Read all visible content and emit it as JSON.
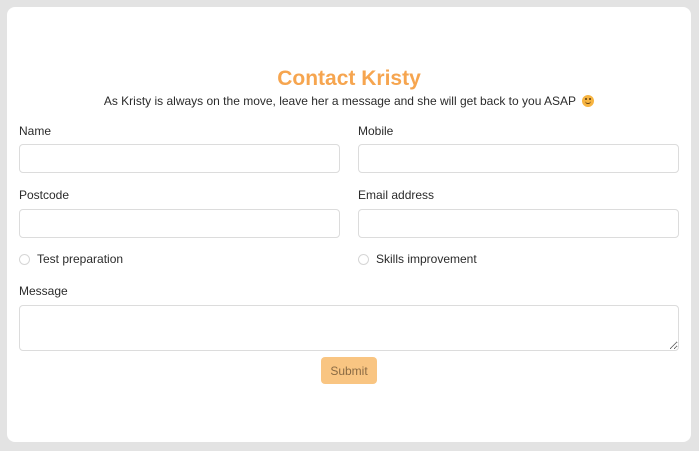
{
  "form": {
    "title": "Contact Kristy",
    "subtitle": "As Kristy is always on the move, leave her a message and she will get back to you ASAP",
    "emoji_icon": "smiling-face-icon",
    "fields": {
      "name": {
        "label": "Name",
        "value": "",
        "placeholder": ""
      },
      "mobile": {
        "label": "Mobile",
        "value": "",
        "placeholder": ""
      },
      "postcode": {
        "label": "Postcode",
        "value": "",
        "placeholder": ""
      },
      "email": {
        "label": "Email address",
        "value": "",
        "placeholder": ""
      },
      "message": {
        "label": "Message",
        "value": "",
        "placeholder": ""
      }
    },
    "options": [
      {
        "label": "Test preparation",
        "selected": false
      },
      {
        "label": "Skills improvement",
        "selected": false
      }
    ],
    "submit_label": "Submit"
  },
  "colors": {
    "accent": "#f6a54f",
    "button_bg": "#f9c582",
    "page_bg": "#e3e3e3"
  }
}
